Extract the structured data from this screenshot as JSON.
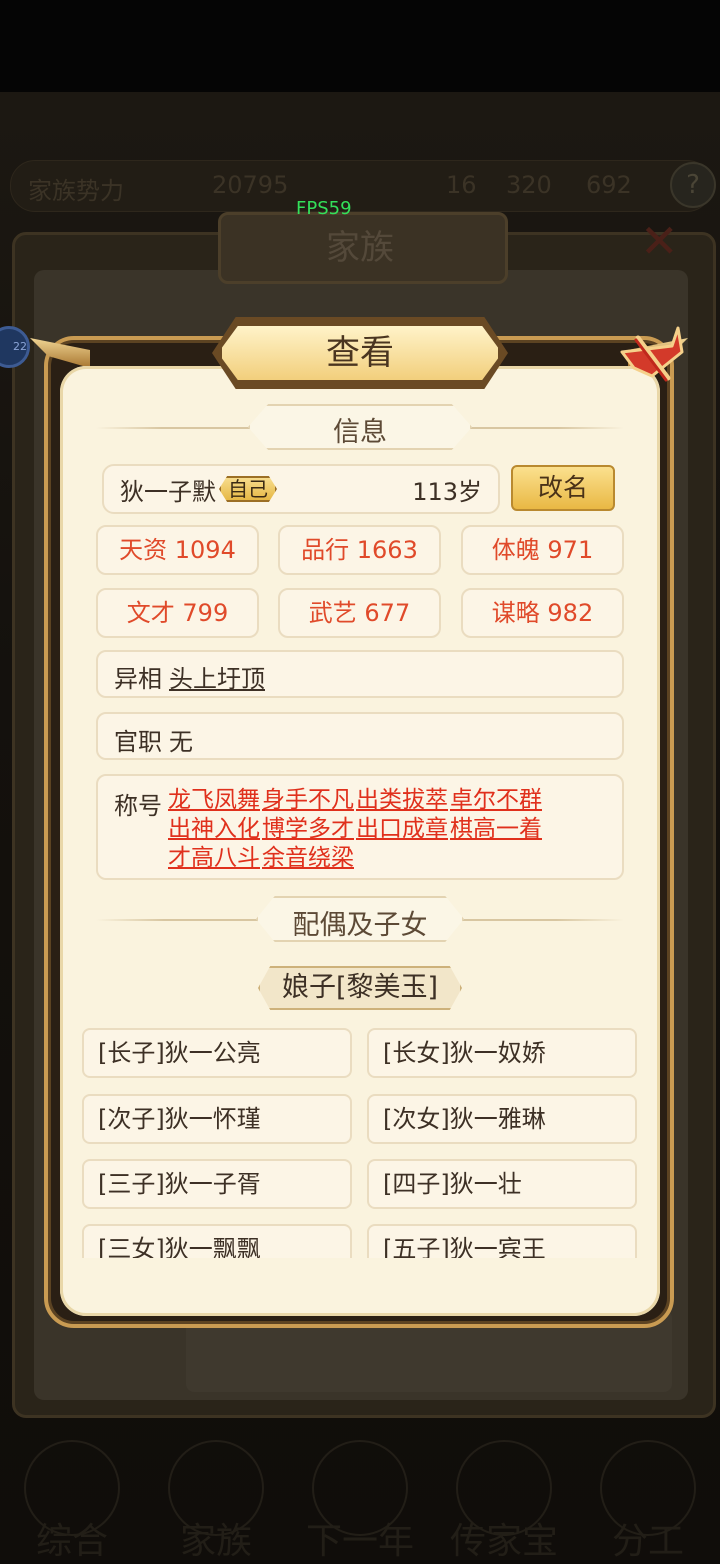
{
  "background": {
    "stats": [
      "家族势力",
      "20795",
      "16",
      "320",
      "692"
    ],
    "screen_title": "家族",
    "avatar_level": "22",
    "nav": [
      "综合",
      "家族",
      "下一年",
      "传家宝",
      "分工"
    ]
  },
  "fps": "FPS59",
  "dialog": {
    "title": "查看",
    "info_header": "信息",
    "name": "狄一子默",
    "self_badge": "自己",
    "age": "113岁",
    "rename_button": "改名",
    "stats": [
      {
        "label": "天资 1094"
      },
      {
        "label": "品行 1663"
      },
      {
        "label": "体魄 971"
      },
      {
        "label": "文才 799"
      },
      {
        "label": "武艺 677"
      },
      {
        "label": "谋略 982"
      }
    ],
    "trait_label": "异相",
    "trait_value": "头上圩顶",
    "office_label": "官职",
    "office_value": "无",
    "titles_label": "称号",
    "titles": [
      "龙飞凤舞",
      "身手不凡",
      "出类拔萃",
      "卓尔不群",
      "出神入化",
      "博学多才",
      "出口成章",
      "棋高一着",
      "才高八斗",
      "余音绕梁"
    ],
    "family_header": "配偶及子女",
    "spouse": "娘子[黎美玉]",
    "children": [
      "[长子]狄一公亮",
      "[长女]狄一奴娇",
      "[次子]狄一怀瑾",
      "[次女]狄一雅琳",
      "[三子]狄一子胥",
      "[四子]狄一壮",
      "[三女]狄一飘飘",
      "[五子]狄一宾王"
    ]
  },
  "colors": {
    "accent_red": "#e04a2a",
    "panel_bg": "#faf3de",
    "gold": "#e9b844"
  }
}
